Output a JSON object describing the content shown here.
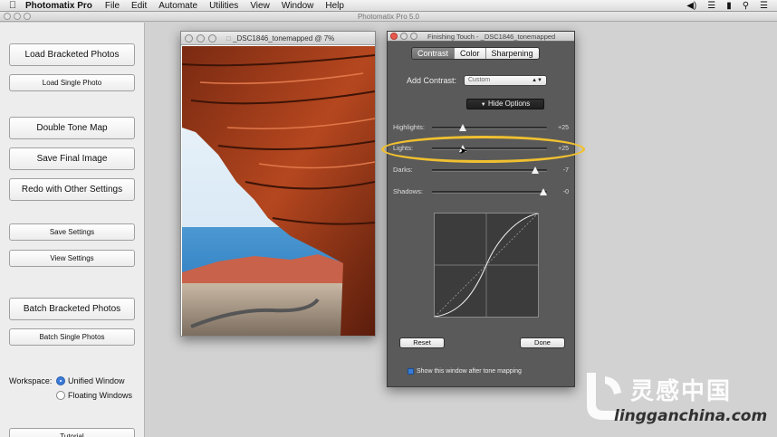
{
  "menubar": {
    "app_name": "Photomatix Pro",
    "items": [
      "File",
      "Edit",
      "Automate",
      "Utilities",
      "View",
      "Window",
      "Help"
    ]
  },
  "app_window": {
    "title": "Photomatix Pro 5.0"
  },
  "left_panel": {
    "load_bracketed": "Load Bracketed Photos",
    "load_single": "Load Single Photo",
    "double_tone_map": "Double Tone Map",
    "save_final": "Save Final Image",
    "redo": "Redo with Other Settings",
    "save_settings": "Save Settings",
    "view_settings": "View Settings",
    "batch_bracketed": "Batch Bracketed Photos",
    "batch_single": "Batch Single Photos",
    "workspace_label": "Workspace:",
    "unified_window": "Unified Window",
    "floating_windows": "Floating Windows",
    "tutorial": "Tutorial"
  },
  "image_window": {
    "title": "_DSC1846_tonemapped @ 7%"
  },
  "finishing_touch": {
    "title": "Finishing Touch - _DSC1846_tonemapped",
    "tabs": [
      "Contrast",
      "Color",
      "Sharpening"
    ],
    "active_tab": "Contrast",
    "add_contrast_label": "Add Contrast:",
    "add_contrast_value": "Custom",
    "hide_options": "Hide Options",
    "sliders": [
      {
        "label": "Highlights:",
        "value": "+25",
        "level": 0.27
      },
      {
        "label": "Lights:",
        "value": "+25",
        "level": 0.27
      },
      {
        "label": "Darks:",
        "value": "-7",
        "level": 0.9
      },
      {
        "label": "Shadows:",
        "value": "-0",
        "level": 0.97
      }
    ],
    "reset": "Reset",
    "done": "Done",
    "show_after": "Show this window after tone mapping"
  },
  "watermark": {
    "text_cn": "灵感中国",
    "url": "lingganchina.com"
  },
  "colors": {
    "highlight_ring": "#f0c030",
    "panel_bg": "#5a5a5a",
    "accent": "#3b7bd9"
  }
}
